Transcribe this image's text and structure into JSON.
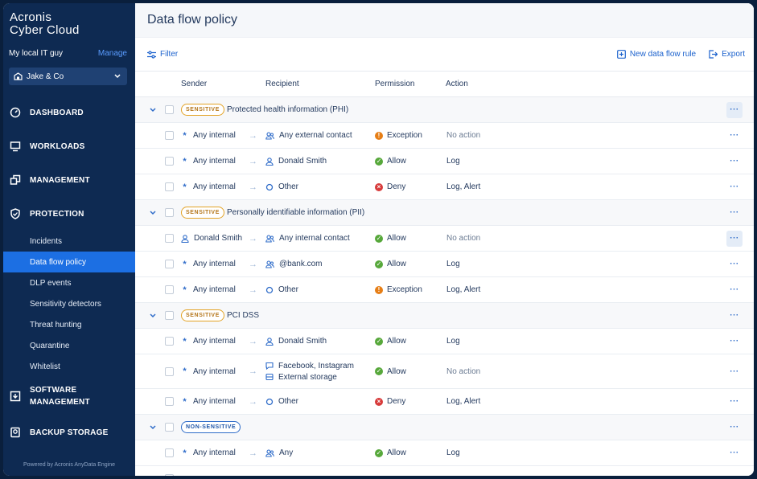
{
  "brand": {
    "line1": "Acronis",
    "line2": "Cyber Cloud"
  },
  "tenant": {
    "name": "My local IT guy",
    "manage": "Manage"
  },
  "customer": {
    "selected": "Jake & Co"
  },
  "nav": {
    "dashboard": "DASHBOARD",
    "workloads": "WORKLOADS",
    "management": "MANAGEMENT",
    "protection": "PROTECTION",
    "sub": [
      "Incidents",
      "Data flow policy",
      "DLP events",
      "Sensitivity detectors",
      "Threat hunting",
      "Quarantine",
      "Whitelist"
    ],
    "software_line1": "SOFTWARE",
    "software_line2": "MANAGEMENT",
    "backup": "BACKUP STORAGE"
  },
  "powered": "Powered by Acronis AnyData Engine",
  "page": {
    "title": "Data flow policy"
  },
  "toolbar": {
    "filter": "Filter",
    "new_rule": "New data flow rule",
    "export": "Export"
  },
  "columns": {
    "sender": "Sender",
    "recipient": "Recipient",
    "permission": "Permission",
    "action": "Action"
  },
  "groups": [
    {
      "badge": "SENSITIVE",
      "label": "Protected health information (PHI)",
      "rules": [
        {
          "sender": "Any internal",
          "recipient": "Any external contact",
          "permission": "Exception",
          "action": "No action"
        },
        {
          "sender": "Any internal",
          "recipient": "Donald Smith",
          "permission": "Allow",
          "action": "Log"
        },
        {
          "sender": "Any internal",
          "recipient": "Other",
          "permission": "Deny",
          "action": "Log, Alert"
        }
      ]
    },
    {
      "badge": "SENSITIVE",
      "label": "Personally identifiable information (PII)",
      "rules": [
        {
          "sender": "Donald Smith",
          "recipient": "Any internal contact",
          "permission": "Allow",
          "action": "No action"
        },
        {
          "sender": "Any internal",
          "recipient": "@bank.com",
          "permission": "Allow",
          "action": "Log"
        },
        {
          "sender": "Any internal",
          "recipient": "Other",
          "permission": "Exception",
          "action": "Log, Alert"
        }
      ]
    },
    {
      "badge": "SENSITIVE",
      "label": "PCI DSS",
      "rules": [
        {
          "sender": "Any internal",
          "recipient": "Donald Smith",
          "permission": "Allow",
          "action": "Log"
        },
        {
          "sender": "Any internal",
          "recipient": "Facebook, Instagram",
          "recipient2": "External storage",
          "permission": "Allow",
          "action": "No action"
        },
        {
          "sender": "Any internal",
          "recipient": "Other",
          "permission": "Deny",
          "action": "Log, Alert"
        }
      ]
    },
    {
      "badge": "NON-SENSITIVE",
      "label": "",
      "rules": [
        {
          "sender": "Any internal",
          "recipient": "Any",
          "permission": "Allow",
          "action": "Log"
        }
      ]
    }
  ],
  "more": "···",
  "colors": {
    "sidebar": "#0e2a52",
    "active": "#1c6fe3",
    "accent": "#1c62cd",
    "allow": "#57a83b",
    "deny": "#d73b3b",
    "exception": "#e67e16",
    "sensitive": "#e3a326"
  }
}
